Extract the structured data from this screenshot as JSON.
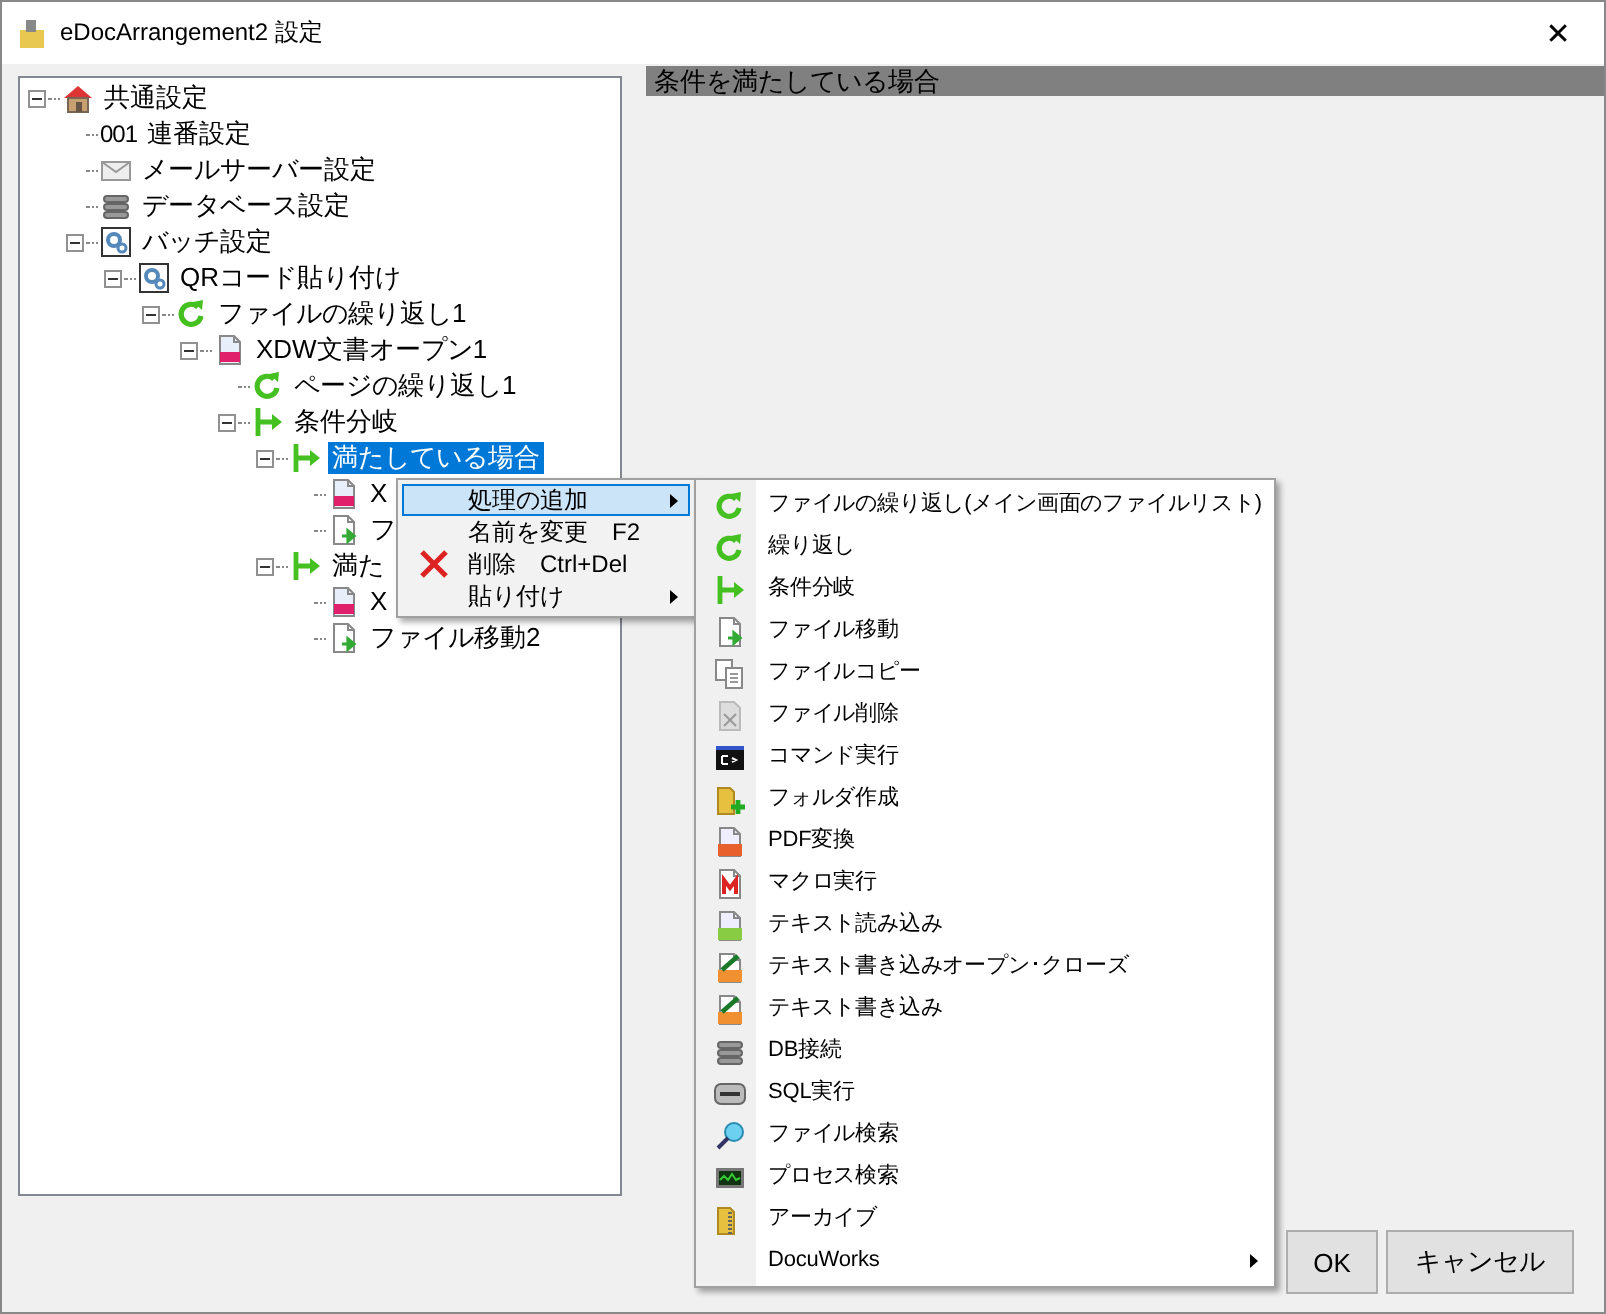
{
  "window": {
    "title": "eDocArrangement2 設定",
    "close": "✕"
  },
  "tree": {
    "nodes": [
      {
        "label": "共通設定",
        "kind": "house",
        "expanded": true,
        "selected": false,
        "children": [
          {
            "label": "連番設定",
            "badge": "001",
            "kind": "counter",
            "selected": false
          },
          {
            "label": "メールサーバー設定",
            "kind": "mail",
            "selected": false
          },
          {
            "label": "データベース設定",
            "kind": "database",
            "selected": false
          },
          {
            "label": "バッチ設定",
            "kind": "gear",
            "expanded": true,
            "selected": false,
            "children": [
              {
                "label": "QRコード貼り付け",
                "kind": "gear",
                "expanded": true,
                "selected": false,
                "children": [
                  {
                    "label": "ファイルの繰り返し1",
                    "kind": "loop",
                    "expanded": true,
                    "selected": false,
                    "children": [
                      {
                        "label": "XDW文書オープン1",
                        "kind": "document",
                        "expanded": true,
                        "selected": false,
                        "children": [
                          {
                            "label": "ページの繰り返し1",
                            "kind": "loop",
                            "selected": false
                          },
                          {
                            "label": "条件分岐",
                            "kind": "branch",
                            "expanded": true,
                            "selected": false,
                            "children": [
                              {
                                "label": "満たしている場合",
                                "kind": "branch",
                                "expanded": true,
                                "selected": true,
                                "children": [
                                  {
                                    "label": "X",
                                    "kind": "document",
                                    "selected": false
                                  },
                                  {
                                    "label": "フ",
                                    "kind": "move",
                                    "selected": false
                                  }
                                ]
                              },
                              {
                                "label": "満た",
                                "kind": "branch",
                                "expanded": true,
                                "selected": false,
                                "children": [
                                  {
                                    "label": "X",
                                    "kind": "document",
                                    "selected": false
                                  },
                                  {
                                    "label": "ファイル移動2",
                                    "kind": "move",
                                    "selected": false
                                  }
                                ]
                              }
                            ]
                          }
                        ]
                      }
                    ]
                  }
                ]
              }
            ]
          }
        ]
      }
    ]
  },
  "panel": {
    "header": "条件を満たしている場合"
  },
  "context_menu": {
    "items": [
      {
        "label": "処理の追加",
        "kind": "plain",
        "submenu": true,
        "selected": true
      },
      {
        "label": "名前を変更",
        "shortcut": "F2",
        "kind": "plain",
        "submenu": false,
        "selected": false
      },
      {
        "label": "削除",
        "shortcut": "Ctrl+Del",
        "kind": "delete",
        "submenu": false,
        "selected": false
      },
      {
        "label": "貼り付け",
        "kind": "plain",
        "submenu": true,
        "selected": false
      }
    ]
  },
  "submenu": {
    "items": [
      {
        "label": "ファイルの繰り返し(メイン画面のファイルリスト)",
        "kind": "loop",
        "submenu": false
      },
      {
        "label": "繰り返し",
        "kind": "loop",
        "submenu": false
      },
      {
        "label": "条件分岐",
        "kind": "branch",
        "submenu": false
      },
      {
        "label": "ファイル移動",
        "kind": "move",
        "submenu": false
      },
      {
        "label": "ファイルコピー",
        "kind": "copy",
        "submenu": false
      },
      {
        "label": "ファイル削除",
        "kind": "remove",
        "submenu": false
      },
      {
        "label": "コマンド実行",
        "kind": "command",
        "submenu": false
      },
      {
        "label": "フォルダ作成",
        "kind": "newfolder",
        "submenu": false
      },
      {
        "label": "PDF変換",
        "kind": "pdf",
        "submenu": false
      },
      {
        "label": "マクロ実行",
        "kind": "macro",
        "submenu": false
      },
      {
        "label": "テキスト読み込み",
        "kind": "textread",
        "submenu": false
      },
      {
        "label": "テキスト書き込みオープン･クローズ",
        "kind": "textwrite",
        "submenu": false
      },
      {
        "label": "テキスト書き込み",
        "kind": "textwrite",
        "submenu": false
      },
      {
        "label": "DB接続",
        "kind": "database",
        "submenu": false
      },
      {
        "label": "SQL実行",
        "kind": "sql",
        "submenu": false
      },
      {
        "label": "ファイル検索",
        "kind": "search",
        "submenu": false
      },
      {
        "label": "プロセス検索",
        "kind": "process",
        "submenu": false
      },
      {
        "label": "アーカイブ",
        "kind": "archive",
        "submenu": false
      },
      {
        "label": "DocuWorks",
        "kind": "plain",
        "submenu": true
      }
    ]
  },
  "buttons": [
    "OK",
    "キャンセル"
  ]
}
